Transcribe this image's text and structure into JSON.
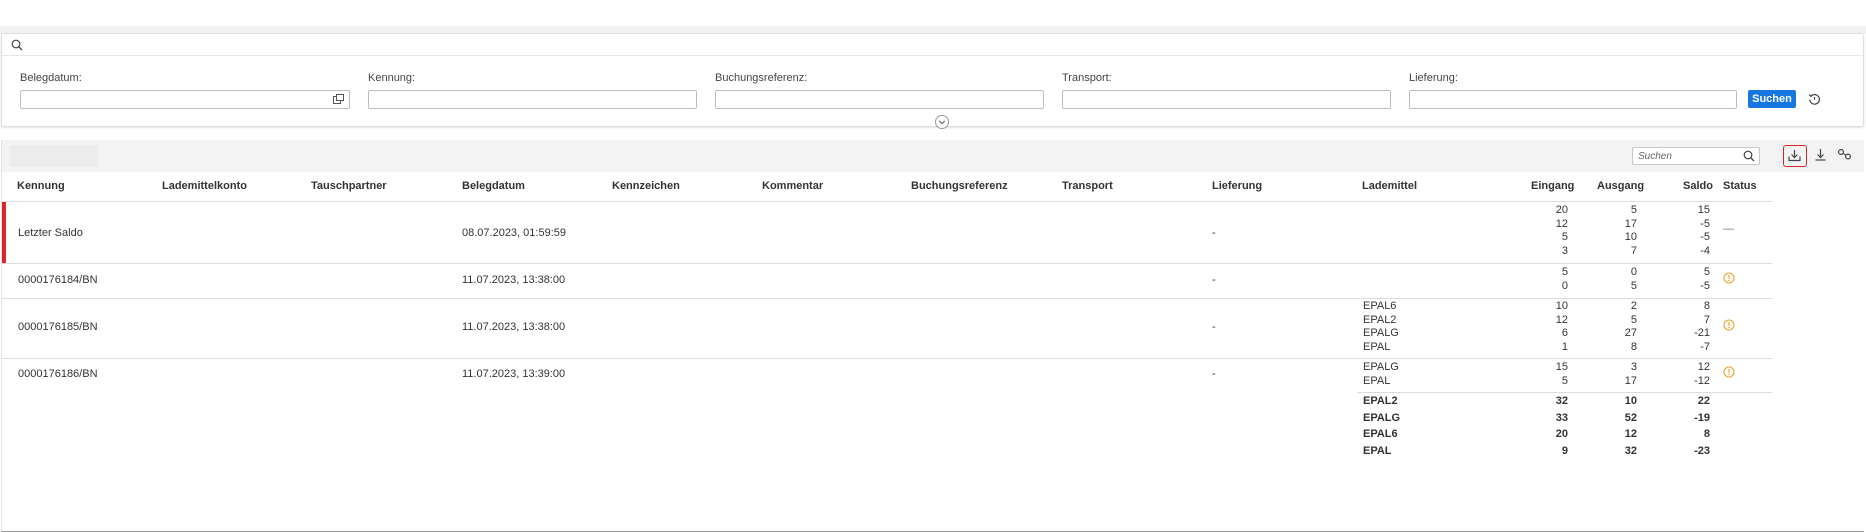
{
  "filter": {
    "fields": [
      {
        "label": "Belegdatum:",
        "value": ""
      },
      {
        "label": "Kennung:",
        "value": ""
      },
      {
        "label": "Buchungsreferenz:",
        "value": ""
      },
      {
        "label": "Transport:",
        "value": ""
      },
      {
        "label": "Lieferung:",
        "value": ""
      }
    ],
    "search_button": "Suchen"
  },
  "toolbar": {
    "search_placeholder": "Suchen"
  },
  "columns": [
    "Kennung",
    "Lademittelkonto",
    "Tauschpartner",
    "Belegdatum",
    "Kennzeichen",
    "Kommentar",
    "Buchungsreferenz",
    "Transport",
    "Lieferung",
    "Lademittel",
    "Eingang",
    "Ausgang",
    "Saldo",
    "Status"
  ],
  "rows": [
    {
      "kennung": "Letzter Saldo",
      "belegdatum": "08.07.2023, 01:59:59",
      "lieferung": "-",
      "lademittel": [
        "",
        "",
        "",
        ""
      ],
      "eingang": [
        "20",
        "12",
        "5",
        "3"
      ],
      "ausgang": [
        "5",
        "17",
        "10",
        "7"
      ],
      "saldo": [
        "15",
        "-5",
        "-5",
        "-4"
      ],
      "status": "dash"
    },
    {
      "kennung": "0000176184/BN",
      "belegdatum": "11.07.2023, 13:38:00",
      "lieferung": "-",
      "lademittel": [
        "",
        ""
      ],
      "eingang": [
        "5",
        "0"
      ],
      "ausgang": [
        "0",
        "5"
      ],
      "saldo": [
        "5",
        "-5"
      ],
      "status": "warning-icon"
    },
    {
      "kennung": "0000176185/BN",
      "belegdatum": "11.07.2023, 13:38:00",
      "lieferung": "-",
      "lademittel": [
        "EPAL6",
        "EPAL2",
        "EPALG",
        "EPAL"
      ],
      "eingang": [
        "10",
        "12",
        "6",
        "1"
      ],
      "ausgang": [
        "2",
        "5",
        "27",
        "8"
      ],
      "saldo": [
        "8",
        "7",
        "-21",
        "-7"
      ],
      "status": "warning-icon"
    },
    {
      "kennung": "0000176186/BN",
      "belegdatum": "11.07.2023, 13:39:00",
      "lieferung": "-",
      "lademittel": [
        "EPALG",
        "EPAL"
      ],
      "eingang": [
        "15",
        "5"
      ],
      "ausgang": [
        "3",
        "17"
      ],
      "saldo": [
        "12",
        "-12"
      ],
      "status": "warning-icon"
    }
  ],
  "totals": {
    "lademittel": [
      "EPAL2",
      "EPALG",
      "EPAL6",
      "EPAL"
    ],
    "eingang": [
      "32",
      "33",
      "20",
      "9"
    ],
    "ausgang": [
      "10",
      "52",
      "12",
      "32"
    ],
    "saldo": [
      "22",
      "-19",
      "8",
      "-23"
    ]
  },
  "colors": {
    "accent": "#1677e0",
    "highlight": "#d9242a",
    "warning": "#f0a22a"
  }
}
